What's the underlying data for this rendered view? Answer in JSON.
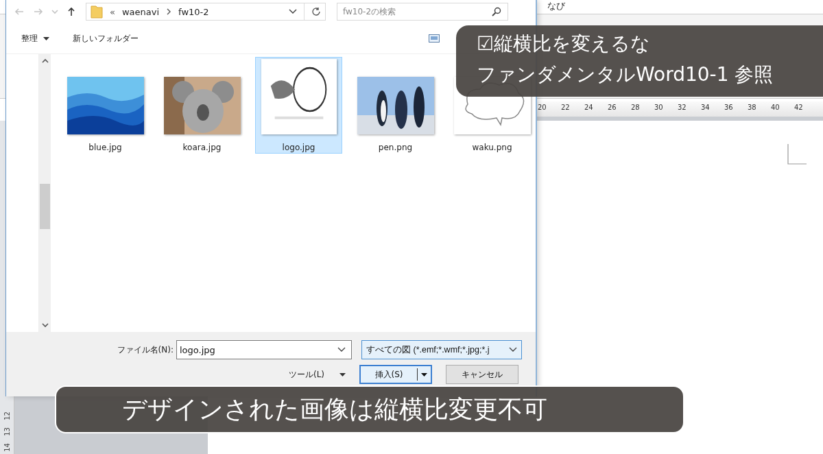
{
  "word": {
    "title_fragment": "なび",
    "ruler_numbers": [
      "20",
      "22",
      "24",
      "26",
      "28",
      "30",
      "32",
      "34",
      "36",
      "38",
      "40",
      "42"
    ],
    "vertical_ruler_numbers": [
      "12",
      "13",
      "14"
    ]
  },
  "dialog": {
    "nav_buttons": [
      {
        "kind": "back",
        "disabled": true
      },
      {
        "kind": "forward",
        "disabled": true
      },
      {
        "kind": "recent",
        "disabled": true
      },
      {
        "kind": "up",
        "disabled": false
      }
    ],
    "breadcrumb": {
      "overflow_mark": "«",
      "items": [
        "waenavi",
        "fw10-2"
      ]
    },
    "search": {
      "placeholder": "fw10-2の検索"
    },
    "toolbar": [
      {
        "label": "整理",
        "dropdown": true
      },
      {
        "label": "新しいフォルダー",
        "dropdown": false
      }
    ],
    "files": [
      {
        "name": "blue.jpg",
        "selected": false
      },
      {
        "name": "koara.jpg",
        "selected": false
      },
      {
        "name": "logo.jpg",
        "selected": true
      },
      {
        "name": "pen.png",
        "selected": false
      },
      {
        "name": "waku.png",
        "selected": false
      }
    ],
    "filename": {
      "label": "ファイル名(N):",
      "value": "logo.jpg"
    },
    "filter": {
      "value": "すべての図 (*.emf;*.wmf;*.jpg;*.j"
    },
    "tools_label": "ツール(L)",
    "insert_button": "挿入(S)",
    "cancel_button": "キャンセル"
  },
  "captions": [
    {
      "lines": [
        "☑縦横比を変えるな",
        "ファンダメンタルWord10-1 参照"
      ]
    },
    {
      "lines": [
        "デザインされた画像は縦横比変更不可"
      ]
    }
  ]
}
